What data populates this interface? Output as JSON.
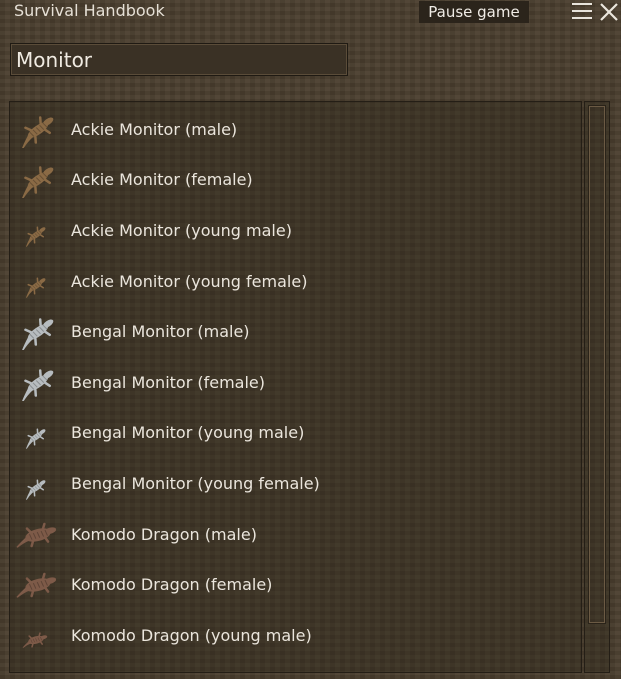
{
  "window": {
    "title": "Survival Handbook",
    "pause_label": "Pause game"
  },
  "search": {
    "value": "Monitor"
  },
  "colors": {
    "ackie": "#8a6a45",
    "bengal": "#b7bcbf",
    "komodo": "#7d5a48"
  },
  "entries": [
    {
      "label": "Ackie Monitor (male)",
      "icon": "ackie-monitor-icon",
      "kind": "ackie",
      "size": "adult"
    },
    {
      "label": "Ackie Monitor (female)",
      "icon": "ackie-monitor-icon",
      "kind": "ackie",
      "size": "adult"
    },
    {
      "label": "Ackie Monitor (young male)",
      "icon": "ackie-monitor-icon",
      "kind": "ackie",
      "size": "young"
    },
    {
      "label": "Ackie Monitor (young female)",
      "icon": "ackie-monitor-icon",
      "kind": "ackie",
      "size": "young"
    },
    {
      "label": "Bengal Monitor (male)",
      "icon": "bengal-monitor-icon",
      "kind": "bengal",
      "size": "adult"
    },
    {
      "label": "Bengal Monitor (female)",
      "icon": "bengal-monitor-icon",
      "kind": "bengal",
      "size": "adult"
    },
    {
      "label": "Bengal Monitor (young male)",
      "icon": "bengal-monitor-icon",
      "kind": "bengal",
      "size": "young"
    },
    {
      "label": "Bengal Monitor (young female)",
      "icon": "bengal-monitor-icon",
      "kind": "bengal",
      "size": "young"
    },
    {
      "label": "Komodo Dragon (male)",
      "icon": "komodo-dragon-icon",
      "kind": "komodo",
      "size": "adult"
    },
    {
      "label": "Komodo Dragon (female)",
      "icon": "komodo-dragon-icon",
      "kind": "komodo",
      "size": "adult"
    },
    {
      "label": "Komodo Dragon (young male)",
      "icon": "komodo-dragon-icon",
      "kind": "komodo",
      "size": "young"
    }
  ]
}
